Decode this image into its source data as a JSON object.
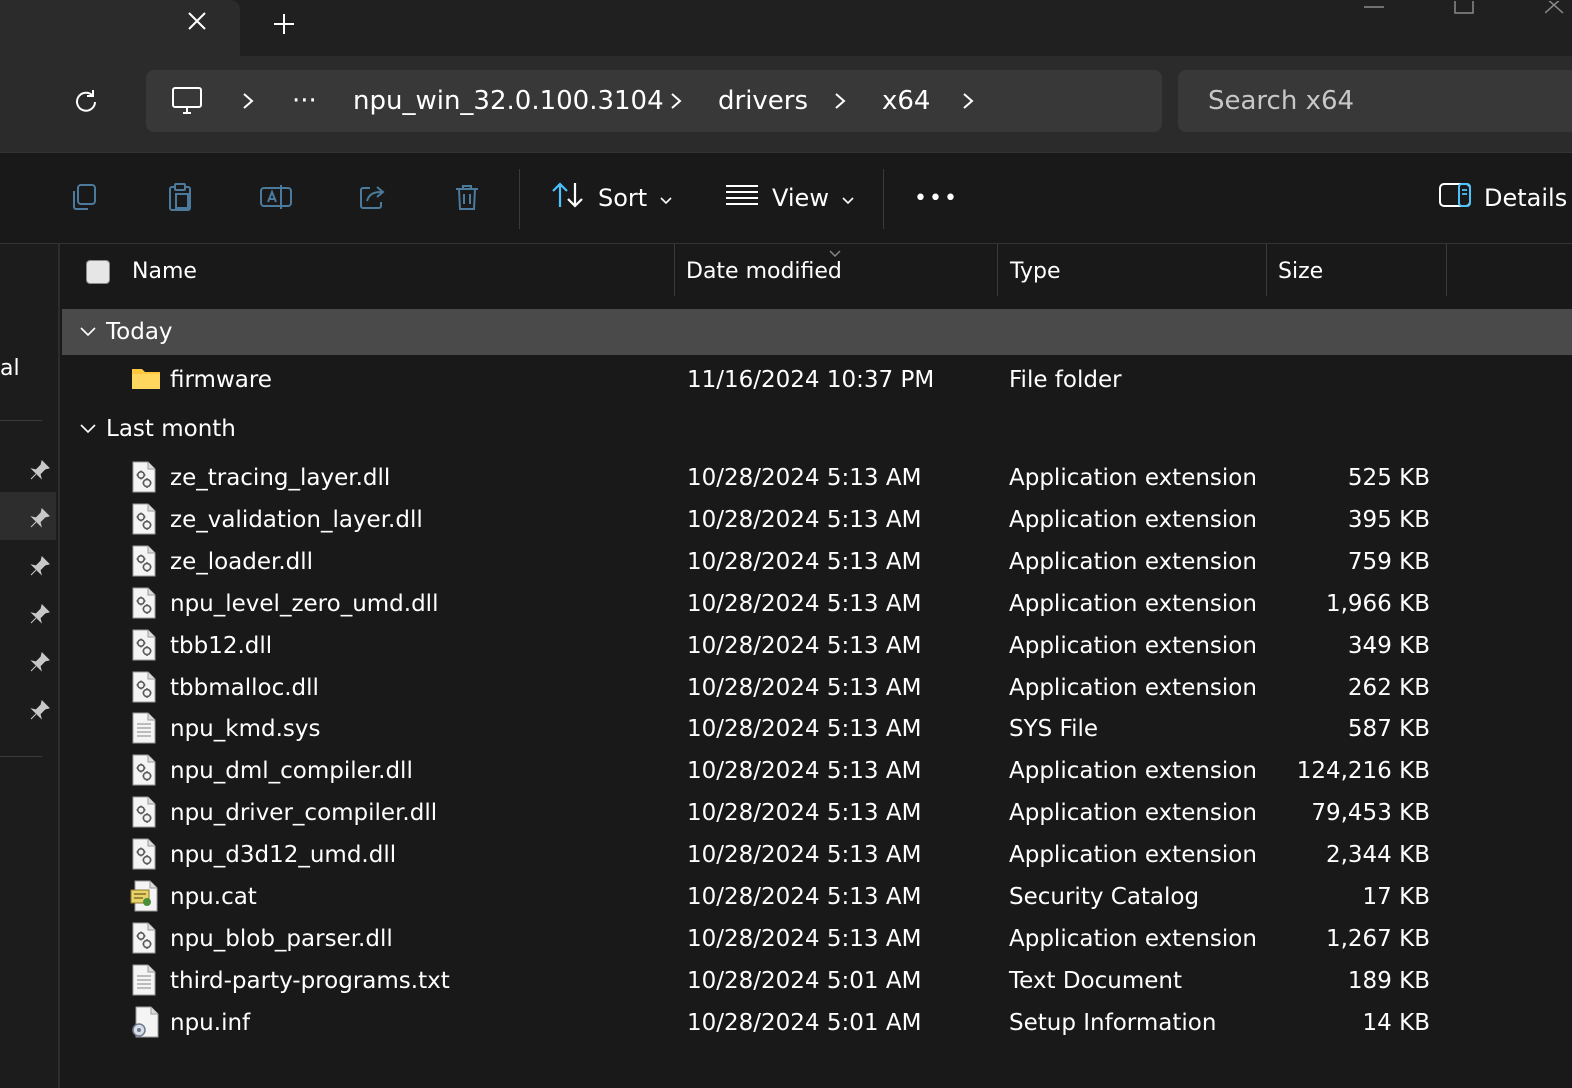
{
  "window": {
    "tab_close_icon": "close-icon",
    "new_tab_icon": "plus-icon"
  },
  "navigation": {
    "refresh_icon": "refresh-icon",
    "breadcrumb": {
      "root_icon": "this-pc-icon",
      "overflow": "···",
      "items": [
        "npu_win_32.0.100.3104",
        "drivers",
        "x64"
      ]
    },
    "search": {
      "placeholder": "Search x64"
    }
  },
  "toolbar": {
    "sort_label": "Sort",
    "view_label": "View",
    "more_label": "•••",
    "details_label": "Details",
    "icons": [
      "copy-icon",
      "paste-icon",
      "rename-icon",
      "share-icon",
      "delete-icon"
    ]
  },
  "sidebar": {
    "partial_label": "al"
  },
  "columns": {
    "name": "Name",
    "date": "Date modified",
    "type": "Type",
    "size": "Size"
  },
  "groups": [
    {
      "label": "Today",
      "items": [
        {
          "name": "firmware",
          "date": "11/16/2024 10:37 PM",
          "type": "File folder",
          "size": "",
          "icon": "folder-icon"
        }
      ]
    },
    {
      "label": "Last month",
      "items": [
        {
          "name": "ze_tracing_layer.dll",
          "date": "10/28/2024 5:13 AM",
          "type": "Application extension",
          "size": "525 KB",
          "icon": "dll-file-icon"
        },
        {
          "name": "ze_validation_layer.dll",
          "date": "10/28/2024 5:13 AM",
          "type": "Application extension",
          "size": "395 KB",
          "icon": "dll-file-icon"
        },
        {
          "name": "ze_loader.dll",
          "date": "10/28/2024 5:13 AM",
          "type": "Application extension",
          "size": "759 KB",
          "icon": "dll-file-icon"
        },
        {
          "name": "npu_level_zero_umd.dll",
          "date": "10/28/2024 5:13 AM",
          "type": "Application extension",
          "size": "1,966 KB",
          "icon": "dll-file-icon"
        },
        {
          "name": "tbb12.dll",
          "date": "10/28/2024 5:13 AM",
          "type": "Application extension",
          "size": "349 KB",
          "icon": "dll-file-icon"
        },
        {
          "name": "tbbmalloc.dll",
          "date": "10/28/2024 5:13 AM",
          "type": "Application extension",
          "size": "262 KB",
          "icon": "dll-file-icon"
        },
        {
          "name": "npu_kmd.sys",
          "date": "10/28/2024 5:13 AM",
          "type": "SYS File",
          "size": "587 KB",
          "icon": "text-file-icon"
        },
        {
          "name": "npu_dml_compiler.dll",
          "date": "10/28/2024 5:13 AM",
          "type": "Application extension",
          "size": "124,216 KB",
          "icon": "dll-file-icon"
        },
        {
          "name": "npu_driver_compiler.dll",
          "date": "10/28/2024 5:13 AM",
          "type": "Application extension",
          "size": "79,453 KB",
          "icon": "dll-file-icon"
        },
        {
          "name": "npu_d3d12_umd.dll",
          "date": "10/28/2024 5:13 AM",
          "type": "Application extension",
          "size": "2,344 KB",
          "icon": "dll-file-icon"
        },
        {
          "name": "npu.cat",
          "date": "10/28/2024 5:13 AM",
          "type": "Security Catalog",
          "size": "17 KB",
          "icon": "security-catalog-icon"
        },
        {
          "name": "npu_blob_parser.dll",
          "date": "10/28/2024 5:13 AM",
          "type": "Application extension",
          "size": "1,267 KB",
          "icon": "dll-file-icon"
        },
        {
          "name": "third-party-programs.txt",
          "date": "10/28/2024 5:01 AM",
          "type": "Text Document",
          "size": "189 KB",
          "icon": "text-file-icon"
        },
        {
          "name": "npu.inf",
          "date": "10/28/2024 5:01 AM",
          "type": "Setup Information",
          "size": "14 KB",
          "icon": "setup-info-icon"
        }
      ]
    }
  ],
  "colors": {
    "accent": "#4cc2ff",
    "group_header_bg": "#4a4a4a",
    "folder": "#ffc83d"
  }
}
